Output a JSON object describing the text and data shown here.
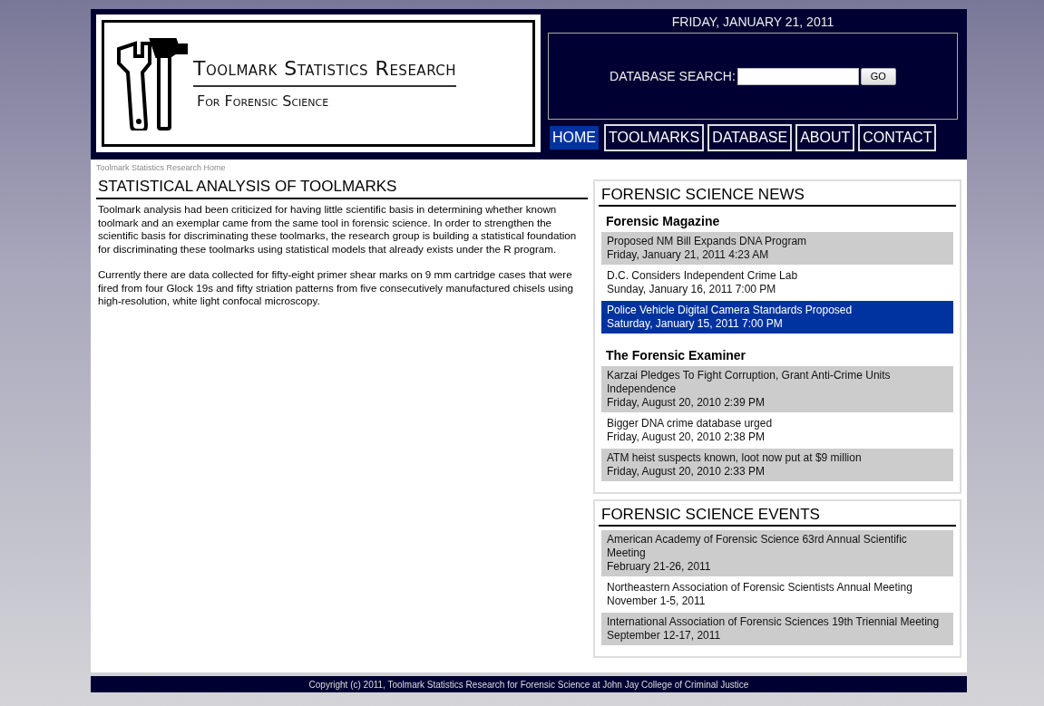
{
  "logo": {
    "title": "Toolmark Statistics Research",
    "subtitle": "For Forensic Science"
  },
  "date": "FRIDAY, JANUARY 21, 2011",
  "search": {
    "label": "DATABASE SEARCH:",
    "button": "GO"
  },
  "nav": [
    {
      "label": "HOME",
      "selected": true
    },
    {
      "label": "TOOLMARKS",
      "selected": false
    },
    {
      "label": "DATABASE",
      "selected": false
    },
    {
      "label": "ABOUT",
      "selected": false
    },
    {
      "label": "CONTACT",
      "selected": false
    }
  ],
  "breadcrumb": "Toolmark Statistics Research Home",
  "article": {
    "title": "STATISTICAL ANALYSIS OF TOOLMARKS",
    "paragraphs": [
      "Toolmark analysis had been criticized for having little scientific basis in determining whether known toolmark and an exemplar came from the same tool in forensic science. In order to strengthen the scientific basis for discriminating these toolmarks, the research group is building a statistical foundation for discriminating these toolmarks using statistical models that already exists under the R program.",
      "Currently there are data collected for fifty-eight primer shear marks on 9 mm cartridge cases that were fired from four Glock 19s and fifty striation patterns from five consecutively manufactured chisels using high-resolution, white light confocal microscopy."
    ]
  },
  "news": {
    "title": "FORENSIC SCIENCE NEWS",
    "sources": [
      {
        "name": "Forensic Magazine",
        "items": [
          {
            "headline": "Proposed NM Bill Expands DNA Program",
            "date": "Friday, January 21, 2011 4:23 AM",
            "selected": false
          },
          {
            "headline": "D.C. Considers Independent Crime Lab",
            "date": "Sunday, January 16, 2011 7:00 PM",
            "selected": false
          },
          {
            "headline": "Police Vehicle Digital Camera Standards Proposed",
            "date": "Saturday, January 15, 2011 7:00 PM",
            "selected": true
          }
        ]
      },
      {
        "name": "The Forensic Examiner",
        "items": [
          {
            "headline": "Karzai Pledges To Fight Corruption, Grant Anti-Crime Units Independence",
            "date": "Friday, August 20, 2010 2:39 PM",
            "selected": false
          },
          {
            "headline": "Bigger DNA crime database urged",
            "date": "Friday, August 20, 2010 2:38 PM",
            "selected": false
          },
          {
            "headline": "ATM heist suspects known, loot now put at $9 million",
            "date": "Friday, August 20, 2010 2:33 PM",
            "selected": false
          }
        ]
      }
    ]
  },
  "events": {
    "title": "FORENSIC SCIENCE EVENTS",
    "items": [
      {
        "name": "American Academy of Forensic Science 63rd Annual Scientific Meeting",
        "date": "February 21-26, 2011"
      },
      {
        "name": "Northeastern Association of Forensic Scientists Annual Meeting",
        "date": "November 1-5, 2011"
      },
      {
        "name": "International Association of Forensic Sciences 19th Triennial Meeting",
        "date": "September 12-17, 2011"
      }
    ]
  },
  "footer": "Copyright (c) 2011, Toolmark Statistics Research for Forensic Science at John Jay College of Criminal Justice"
}
